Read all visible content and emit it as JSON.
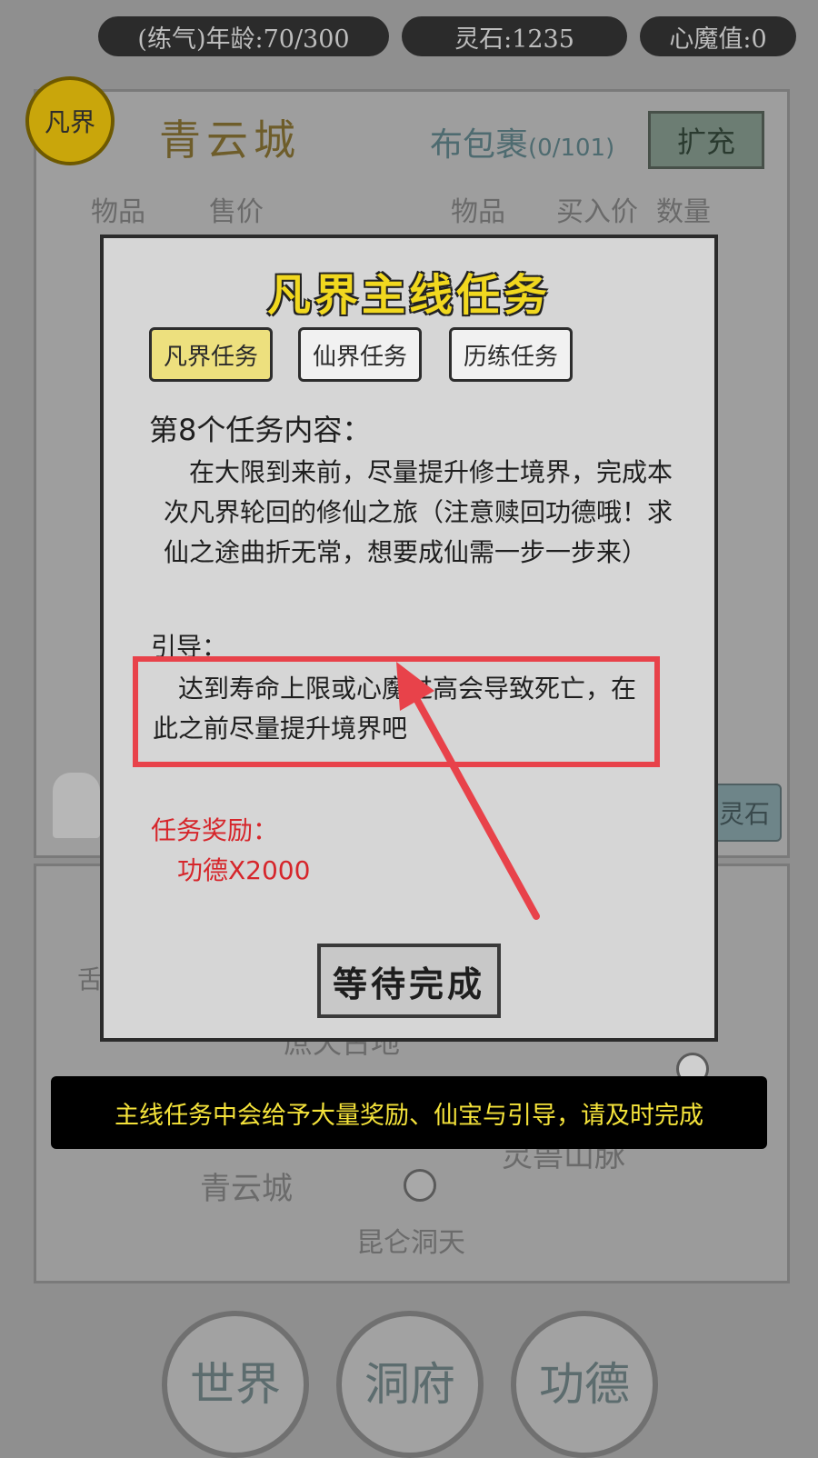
{
  "status": {
    "age": "(练气)年龄:70/300",
    "spirit_stones": "灵石:1235",
    "demon_value": "心魔值:0"
  },
  "logo_text": "凡界",
  "shop": {
    "city_name": "青云城",
    "bag_title": "布包裹",
    "bag_count": "(0/101)",
    "expand_button": "扩充",
    "left_headers": [
      "物品",
      "售价"
    ],
    "right_headers": [
      "物品",
      "买入价",
      "数量"
    ],
    "stone_button": "灵石"
  },
  "map": {
    "labels": [
      "青云城",
      "灵兽山脉",
      "昆仑洞天",
      "庶天古地",
      "舌"
    ]
  },
  "nav": [
    {
      "label": "世界"
    },
    {
      "label": "洞府"
    },
    {
      "label": "功德"
    }
  ],
  "modal": {
    "title": "凡界主线任务",
    "tabs": [
      {
        "label": "凡界任务",
        "active": true
      },
      {
        "label": "仙界任务",
        "active": false
      },
      {
        "label": "历练任务",
        "active": false
      }
    ],
    "quest_heading": "第8个任务内容：",
    "quest_body": "在大限到来前，尽量提升修士境界，完成本次凡界轮回的修仙之旅（注意赎回功德哦！求仙之途曲折无常，想要成仙需一步一步来）",
    "guide_label": "引导：",
    "guide_text": "达到寿命上限或心魔过高会导致死亡，在此之前尽量提升境界吧",
    "reward_label": "任务奖励：",
    "reward_value": "功德X2000",
    "action_button": "等待完成"
  },
  "tip": "主线任务中会给予大量奖励、仙宝与引导，请及时完成",
  "colors": {
    "highlight": "#e8424a",
    "title_gold": "#f1d81f",
    "reward_red": "#d6262b",
    "active_tab": "#ede07e",
    "tip_text": "#f4e23a"
  }
}
